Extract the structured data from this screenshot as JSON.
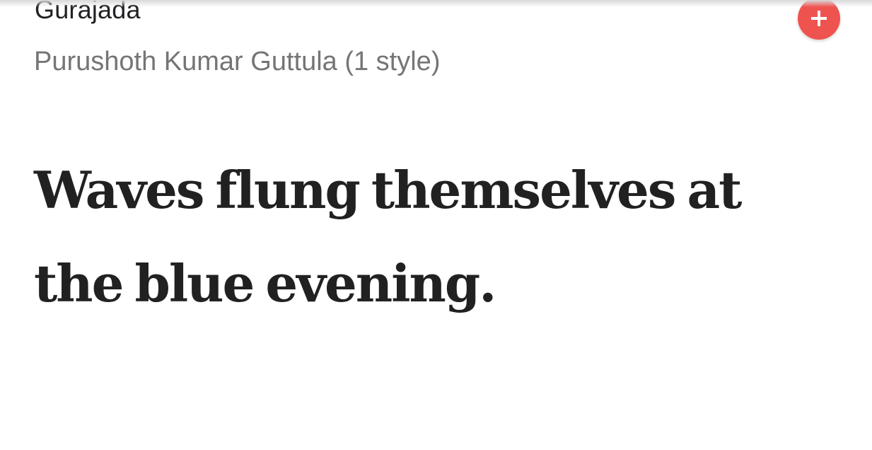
{
  "font_card": {
    "font_name": "Gurajada",
    "designer_line": "Purushoth Kumar Guttula (1 style)",
    "sample_text": "Waves flung themselves at the blue evening.",
    "add_button_color": "#ef5350"
  },
  "icons": {
    "add": "plus-icon"
  }
}
